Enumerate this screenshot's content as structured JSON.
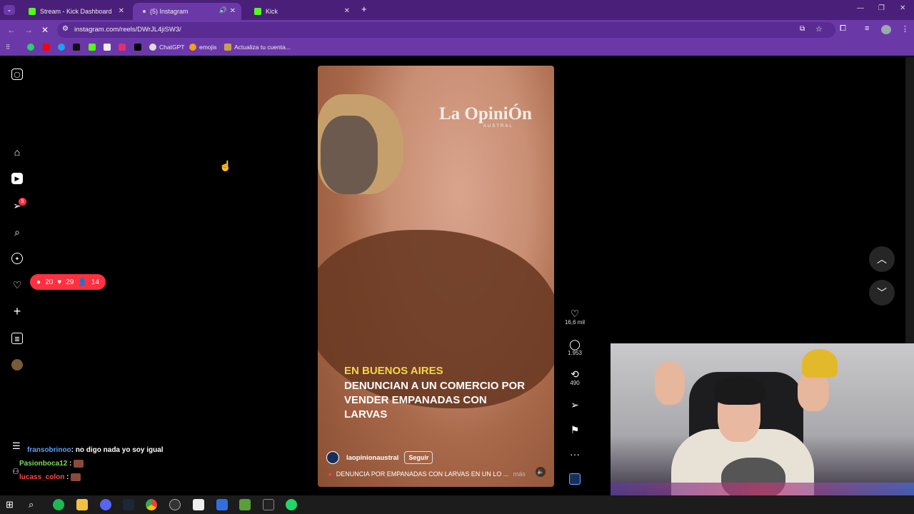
{
  "browser": {
    "tabs": [
      {
        "label": "Stream - Kick Dashboard",
        "active": false
      },
      {
        "label": "(5) Instagram",
        "active": true
      },
      {
        "label": "Kick",
        "active": false
      }
    ],
    "url": "instagram.com/reels/DWrJL4jiSW3/",
    "bookmarks": [
      "ChatGPT",
      "emojis",
      "Actualiza tu cuenta..."
    ],
    "colors": {
      "frame": "#4a1f7a",
      "toolbar": "#6b38a8",
      "kick_green": "#53fc18"
    }
  },
  "instagram": {
    "sidebar_icons": [
      "instagram-icon",
      "home-icon",
      "reels-icon",
      "messages-icon",
      "search-icon",
      "explore-icon",
      "notifications-icon",
      "create-icon",
      "dashboard-icon",
      "profile-avatar"
    ],
    "messages_badge": "5",
    "notification_pill": {
      "comments": "20",
      "likes": "29",
      "follows": "14"
    },
    "reel": {
      "logo": "La OpiniÓn",
      "logo_sub": "AUSTRAL",
      "headline_1": "EN BUENOS AIRES",
      "headline_2": "DENUNCIAN A UN COMERCIO POR VENDER EMPANADAS CON LARVAS",
      "account": "laopinionaustral",
      "follow_label": "Seguir",
      "caption": "🔺 DENUNCIA POR EMPANADAS CON LARVAS EN UN LO ...",
      "more_label": "más"
    },
    "actions": {
      "likes": "16,6 mil",
      "comments": "1.953",
      "reposts": "490"
    }
  },
  "stream_chat": [
    {
      "user": "fransobrinoo",
      "message": ": no digo nada yo soy igual",
      "color": "#5aa0ff"
    },
    {
      "user": "Pasionboca12",
      "message": " :",
      "color": "#7ed957"
    },
    {
      "user": "lucass_colon",
      "message": " :",
      "color": "#ff4b4b"
    }
  ]
}
